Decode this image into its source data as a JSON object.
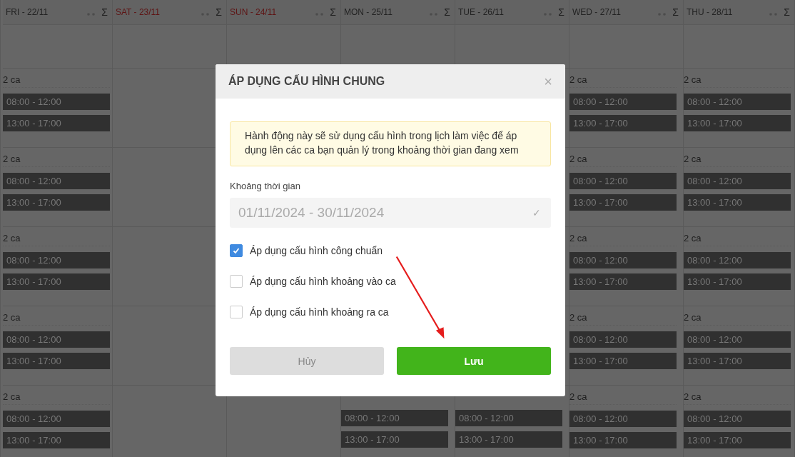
{
  "days": [
    {
      "label": "FRI - 22/11",
      "weekend": false,
      "sum_icon": "Σ",
      "cells": [
        {
          "count": "2 ca",
          "shifts": [
            "08:00 - 12:00",
            "13:00 - 17:00"
          ]
        },
        {
          "count": "2 ca",
          "shifts": [
            "08:00 - 12:00",
            "13:00 - 17:00"
          ]
        },
        {
          "count": "2 ca",
          "shifts": [
            "08:00 - 12:00",
            "13:00 - 17:00"
          ]
        },
        {
          "count": "2 ca",
          "shifts": [
            "08:00 - 12:00",
            "13:00 - 17:00"
          ]
        },
        {
          "count": "2 ca",
          "shifts": [
            "08:00 - 12:00",
            "13:00 - 17:00"
          ]
        }
      ]
    },
    {
      "label": "SAT - 23/11",
      "weekend": true,
      "sum_icon": "Σ",
      "cells": [
        {},
        {},
        {},
        {},
        {}
      ]
    },
    {
      "label": "SUN - 24/11",
      "weekend": true,
      "sum_icon": "Σ",
      "cells": [
        {},
        {},
        {},
        {},
        {}
      ]
    },
    {
      "label": "MON - 25/11",
      "weekend": false,
      "sum_icon": "Σ",
      "cells": [
        {},
        {},
        {},
        {},
        {
          "shifts": [
            "08:00 - 12:00",
            "13:00 - 17:00"
          ]
        }
      ]
    },
    {
      "label": "TUE - 26/11",
      "weekend": false,
      "sum_icon": "Σ",
      "cells": [
        {},
        {},
        {},
        {},
        {
          "shifts": [
            "08:00 - 12:00",
            "13:00 - 17:00"
          ]
        }
      ]
    },
    {
      "label": "WED - 27/11",
      "weekend": false,
      "sum_icon": "Σ",
      "cells": [
        {
          "count": "2 ca",
          "shifts": [
            "08:00 - 12:00",
            "13:00 - 17:00"
          ]
        },
        {
          "count": "2 ca",
          "shifts": [
            "08:00 - 12:00",
            "13:00 - 17:00"
          ]
        },
        {
          "count": "2 ca",
          "shifts": [
            "08:00 - 12:00",
            "13:00 - 17:00"
          ]
        },
        {
          "count": "2 ca",
          "shifts": [
            "08:00 - 12:00",
            "13:00 - 17:00"
          ]
        },
        {
          "count": "2 ca",
          "shifts": [
            "08:00 - 12:00",
            "13:00 - 17:00"
          ]
        }
      ]
    },
    {
      "label": "THU - 28/11",
      "weekend": false,
      "sum_icon": "Σ",
      "cells": [
        {
          "count": "2 ca",
          "shifts": [
            "08:00 - 12:00",
            "13:00 - 17:00"
          ]
        },
        {
          "count": "2 ca",
          "shifts": [
            "08:00 - 12:00",
            "13:00 - 17:00"
          ]
        },
        {
          "count": "2 ca",
          "shifts": [
            "08:00 - 12:00",
            "13:00 - 17:00"
          ]
        },
        {
          "count": "2 ca",
          "shifts": [
            "08:00 - 12:00",
            "13:00 - 17:00"
          ]
        },
        {
          "count": "2 ca",
          "shifts": [
            "08:00 - 12:00",
            "13:00 - 17:00"
          ]
        }
      ]
    }
  ],
  "dialog": {
    "title": "ÁP DỤNG CẤU HÌNH CHUNG",
    "close": "×",
    "notice": "Hành động này sẽ sử dụng cấu hình trong lịch làm việc để áp dụng lên các ca bạn quản lý trong khoảng thời gian đang xem",
    "range_label": "Khoảng thời gian",
    "range_value": "01/11/2024 - 30/11/2024",
    "range_icon": "✓",
    "options": [
      {
        "label": "Áp dụng cấu hình công chuẩn",
        "checked": true
      },
      {
        "label": "Áp dụng cấu hình khoảng vào ca",
        "checked": false
      },
      {
        "label": "Áp dụng cấu hình khoảng ra ca",
        "checked": false
      }
    ],
    "buttons": [
      {
        "label": "Hủy",
        "kind": "cancel"
      },
      {
        "label": "Lưu",
        "kind": "primary"
      }
    ]
  }
}
